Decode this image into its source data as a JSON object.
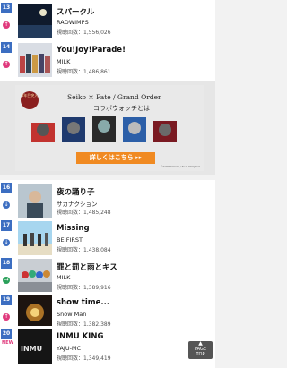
{
  "rows_top": [
    {
      "rank": "13",
      "trend": "up",
      "title": "スパークル",
      "artist": "RADWIMPS",
      "views": "視聴回数：1,556,026"
    },
    {
      "rank": "14",
      "trend": "up",
      "title": "You!Joy!Parade!",
      "artist": "MILK",
      "views": "視聴回数：1,486,861"
    }
  ],
  "ad": {
    "seal": "8年目突入",
    "title": "Seiko × Fate / Grand Order",
    "subtitle": "コラボウォッチとは",
    "button": "詳しくはこちら ▸▸",
    "credit": "©TYPE-MOON / FGO PROJECT"
  },
  "rows_bottom": [
    {
      "rank": "16",
      "trend": "down",
      "title": "夜の踊り子",
      "artist": "サカナクション",
      "views": "視聴回数：1,485,248"
    },
    {
      "rank": "17",
      "trend": "down",
      "title": "Missing",
      "artist": "BE:FIRST",
      "views": "視聴回数：1,438,084"
    },
    {
      "rank": "18",
      "trend": "same",
      "title": "罪と罰と雨とキス",
      "artist": "MILK",
      "views": "視聴回数：1,389,916"
    },
    {
      "rank": "19",
      "trend": "up",
      "title": "show time...",
      "artist": "Snow Man",
      "views": "視聴回数：1,382,389"
    },
    {
      "rank": "20",
      "trend": "new",
      "title": "INMU KING",
      "artist": "YAJU-MC",
      "views": "視聴回数：1,349,419"
    }
  ],
  "new_label": "NEW",
  "page_top": {
    "line1": "PAGE",
    "line2": "TOP"
  },
  "colors": {
    "rank_bg": "#3c6ec1",
    "up": "#e0397c",
    "down": "#3c6ec1",
    "same": "#2aa05a",
    "ad_button": "#f08a22"
  }
}
